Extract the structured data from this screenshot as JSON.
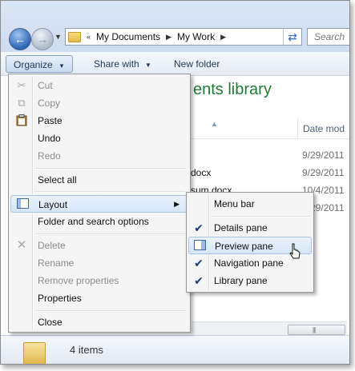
{
  "address_bar": {
    "overflow_chevron": "«",
    "crumbs": [
      "My Documents",
      "My Work"
    ],
    "search_placeholder": "Search"
  },
  "toolbar": {
    "organize_label": "Organize",
    "share_label": "Share with",
    "newfolder_label": "New folder"
  },
  "content": {
    "library_title": "ents library",
    "date_column": "Date mod",
    "files": [
      {
        "name": "",
        "date": "9/29/2011"
      },
      {
        "name": "docx",
        "date": "9/29/2011"
      },
      {
        "name": "sum.docx",
        "date": "10/4/2011"
      },
      {
        "name": "",
        "date": "9/29/2011"
      }
    ]
  },
  "details_pane": {
    "items_count": "4 items"
  },
  "organize_menu": {
    "cut": "Cut",
    "copy": "Copy",
    "paste": "Paste",
    "undo": "Undo",
    "redo": "Redo",
    "select_all": "Select all",
    "layout": "Layout",
    "folder_options": "Folder and search options",
    "delete": "Delete",
    "rename": "Rename",
    "remove_properties": "Remove properties",
    "properties": "Properties",
    "close": "Close"
  },
  "layout_submenu": {
    "menu_bar": "Menu bar",
    "details_pane": "Details pane",
    "preview_pane": "Preview pane",
    "navigation_pane": "Navigation pane",
    "library_pane": "Library pane"
  },
  "colors": {
    "library_title": "#1e7d34",
    "highlight": "#d5e6f8",
    "toolbar_text": "#1e395b"
  }
}
